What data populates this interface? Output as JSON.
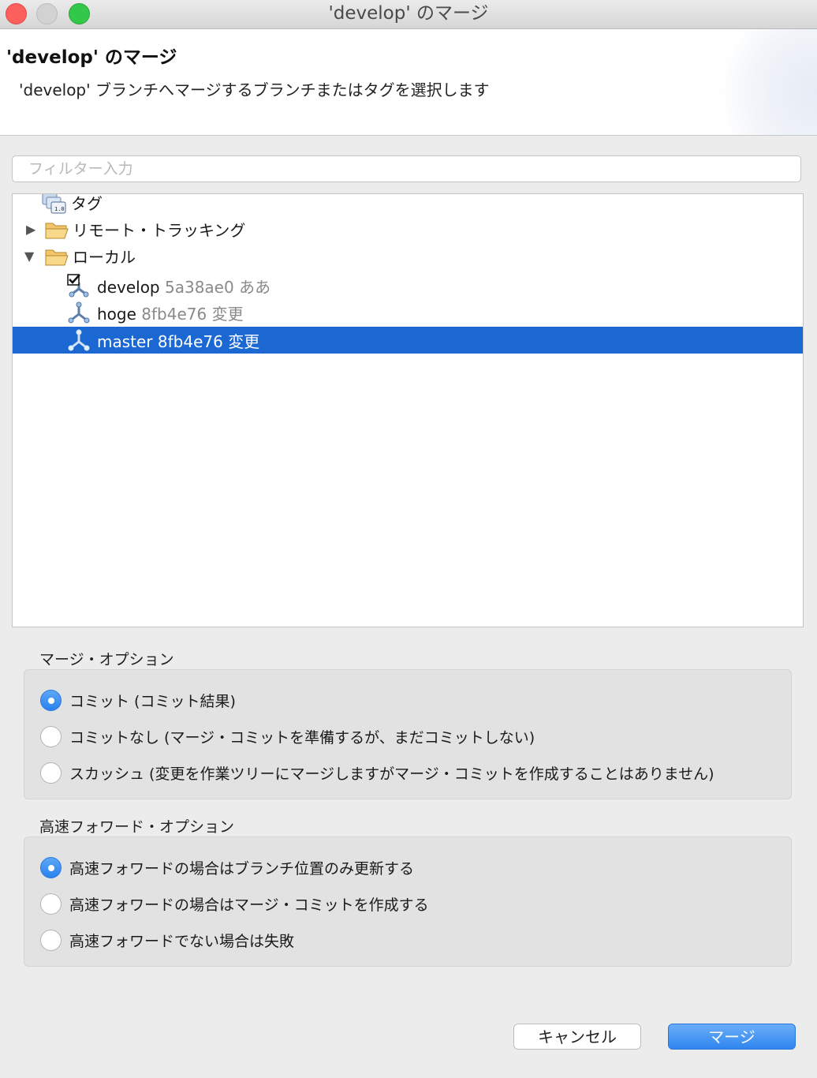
{
  "window": {
    "title": "'develop' のマージ"
  },
  "banner": {
    "title": "'develop' のマージ",
    "description": "'develop' ブランチへマージするブランチまたはタグを選択します"
  },
  "filter": {
    "placeholder": "フィルター入力",
    "value": ""
  },
  "tree": {
    "tags_label": "タグ",
    "remote_label": "リモート・トラッキング",
    "local_label": "ローカル",
    "branches": [
      {
        "name": "develop",
        "meta": "5a38ae0 ああ",
        "checked_out": true,
        "selected": false
      },
      {
        "name": "hoge",
        "meta": "8fb4e76 変更",
        "checked_out": false,
        "selected": false
      },
      {
        "name": "master",
        "meta": "8fb4e76 変更",
        "checked_out": false,
        "selected": true
      }
    ]
  },
  "merge_options": {
    "label": "マージ・オプション",
    "options": [
      {
        "label": "コミット (コミット結果)",
        "selected": true
      },
      {
        "label": "コミットなし (マージ・コミットを準備するが、まだコミットしない)",
        "selected": false
      },
      {
        "label": "スカッシュ (変更を作業ツリーにマージしますがマージ・コミットを作成することはありません)",
        "selected": false
      }
    ]
  },
  "ff_options": {
    "label": "高速フォワード・オプション",
    "options": [
      {
        "label": "高速フォワードの場合はブランチ位置のみ更新する",
        "selected": true
      },
      {
        "label": "高速フォワードの場合はマージ・コミットを作成する",
        "selected": false
      },
      {
        "label": "高速フォワードでない場合は失敗",
        "selected": false
      }
    ]
  },
  "buttons": {
    "cancel": "キャンセル",
    "merge": "マージ"
  },
  "colors": {
    "selection": "#1b68d3",
    "primary_button": "#2f86ef"
  }
}
